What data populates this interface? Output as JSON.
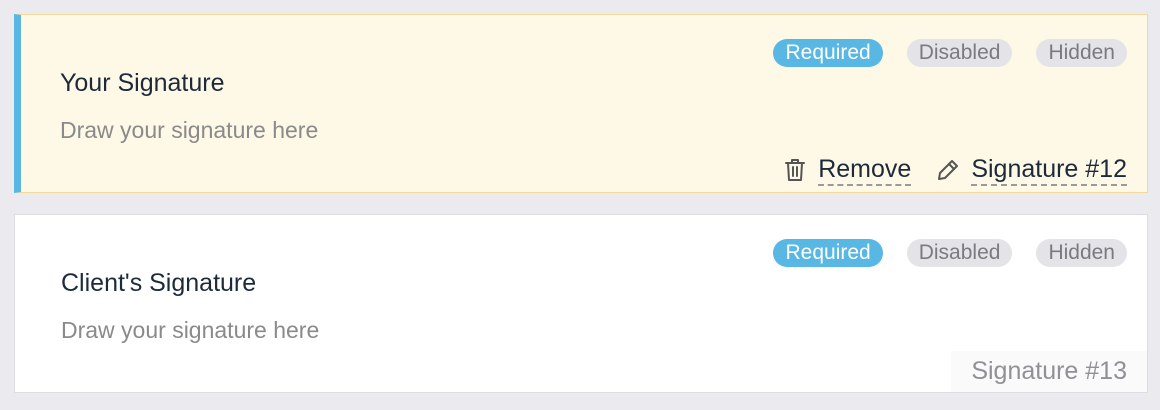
{
  "fields": [
    {
      "title": "Your Signature",
      "placeholder": "Draw your signature here",
      "badges": {
        "required": "Required",
        "disabled": "Disabled",
        "hidden": "Hidden"
      },
      "remove_label": "Remove",
      "field_name": "Signature #12",
      "trash_icon": "trash-icon",
      "pencil_icon": "pencil-icon"
    },
    {
      "title": "Client's Signature",
      "placeholder": "Draw your signature here",
      "badges": {
        "required": "Required",
        "disabled": "Disabled",
        "hidden": "Hidden"
      },
      "field_name": "Signature #13"
    }
  ],
  "colors": {
    "accent": "#58b8e3",
    "active_background": "#fef8e7",
    "active_border": "#f2d99a",
    "page_background": "#ebebef",
    "badge_off": "#e3e3e8"
  }
}
